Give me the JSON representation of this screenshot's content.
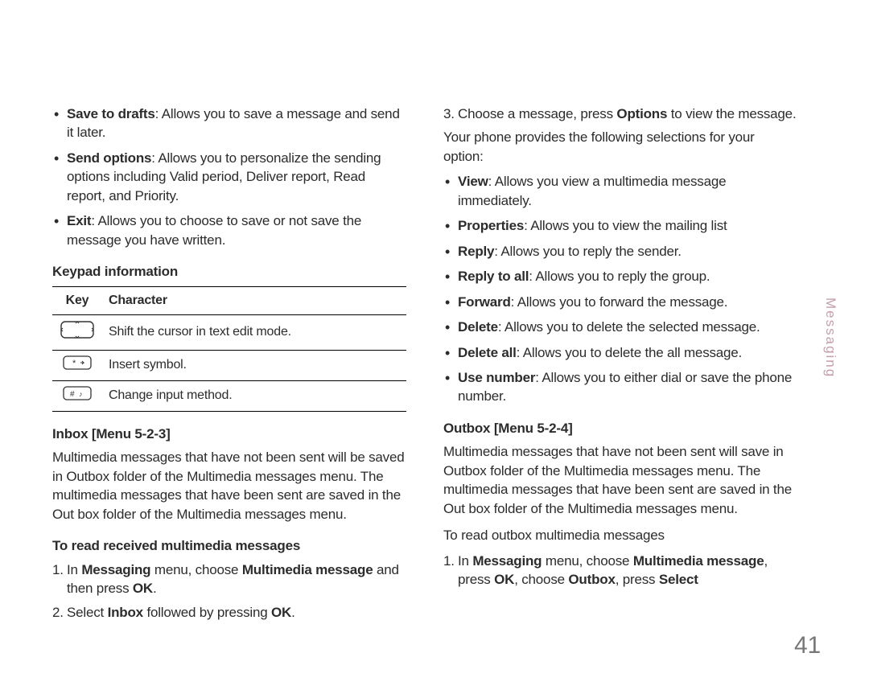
{
  "side_label": "Messaging",
  "page_number": "41",
  "left": {
    "bullets_top": [
      {
        "bold": "Save to drafts",
        "text": ": Allows you to save a message and send it later."
      },
      {
        "bold": "Send options",
        "text": ": Allows you to personalize the sending options including Valid period, Deliver report, Read report, and Priority."
      },
      {
        "bold": "Exit",
        "text": ": Allows you to choose to save or not save the message you have written."
      }
    ],
    "keypad_heading": "Keypad information",
    "table": {
      "header": {
        "key": "Key",
        "character": "Character"
      },
      "rows": [
        {
          "icon": "dpad",
          "text": "Shift the cursor in text edit mode."
        },
        {
          "icon": "star",
          "text": "Insert symbol."
        },
        {
          "icon": "hash",
          "text": "Change input method."
        }
      ]
    },
    "inbox_heading": "Inbox [Menu 5-2-3]",
    "inbox_para": "Multimedia messages that have not been sent will be saved in Outbox folder of the Multimedia messages menu. The multimedia messages that have been sent are saved in the Out box folder of the Multimedia messages menu.",
    "read_heading": "To read received multimedia messages",
    "steps": [
      {
        "n": "1.",
        "pre": "In ",
        "b1": "Messaging",
        "mid1": " menu, choose ",
        "b2": "Multimedia message",
        "mid2": " and then press ",
        "b3": "OK",
        "tail": "."
      },
      {
        "n": "2.",
        "pre": "Select ",
        "b1": "Inbox",
        "mid1": " followed by pressing ",
        "b2": "OK",
        "tail": "."
      }
    ]
  },
  "right": {
    "step3": {
      "n": "3.",
      "pre": "Choose a message, press ",
      "b1": "Options",
      "tail": " to view the message."
    },
    "intro": "Your phone provides the following selections for your option:",
    "options": [
      {
        "bold": "View",
        "text": ": Allows you view a multimedia message immediately."
      },
      {
        "bold": "Properties",
        "text": ": Allows you to view the mailing list"
      },
      {
        "bold": "Reply",
        "text": ": Allows you to reply the sender."
      },
      {
        "bold": "Reply to all",
        "text": ": Allows you to reply the group."
      },
      {
        "bold": "Forward",
        "text": ": Allows you to forward the message."
      },
      {
        "bold": "Delete",
        "text": ": Allows you to delete the selected message."
      },
      {
        "bold": "Delete all",
        "text": ": Allows you to delete the all message."
      },
      {
        "bold": "Use number",
        "text": ": Allows you to either dial or save the phone number."
      }
    ],
    "outbox_heading": "Outbox [Menu 5-2-4]",
    "outbox_para": "Multimedia messages that have not been sent will save in Outbox folder of the Multimedia messages menu. The multimedia messages that have been sent are saved in the Out box folder of the Multimedia messages menu.",
    "read_outbox": "To read outbox multimedia messages",
    "outbox_step": {
      "n": "1.",
      "pre": "In ",
      "b1": "Messaging",
      "mid1": " menu, choose ",
      "b2": "Multimedia message",
      "mid2": ", press ",
      "b3": "OK",
      "mid3": ", choose ",
      "b4": "Outbox",
      "mid4": ", press ",
      "b5": "Select"
    }
  }
}
